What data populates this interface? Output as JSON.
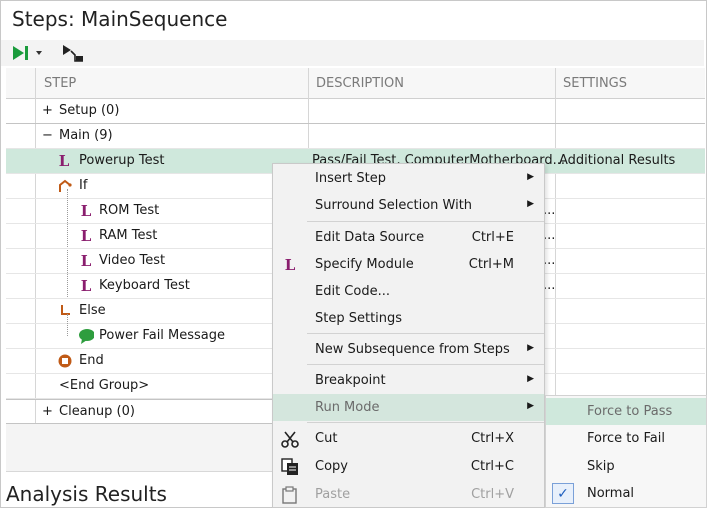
{
  "title": "Steps: MainSequence",
  "columns": [
    "STEP",
    "DESCRIPTION",
    "SETTINGS"
  ],
  "rows": [
    {
      "label": "Setup (0)",
      "expander": "+"
    },
    {
      "label": "Main (9)",
      "expander": "−"
    },
    {
      "label": "Powerup Test",
      "description": "Pass/Fail Test,  ComputerMotherboard...",
      "settings": "Additional Results",
      "icon": "labview-module-icon"
    },
    {
      "label": "If",
      "icon": "if-icon"
    },
    {
      "label": "ROM Test",
      "icon": "labview-module-icon",
      "description": "..."
    },
    {
      "label": "RAM Test",
      "icon": "labview-module-icon",
      "description": "..."
    },
    {
      "label": "Video Test",
      "icon": "labview-module-icon",
      "description": "..."
    },
    {
      "label": "Keyboard Test",
      "icon": "labview-module-icon",
      "description": "..."
    },
    {
      "label": "Else",
      "icon": "else-icon"
    },
    {
      "label": "Power Fail Message",
      "icon": "message-icon"
    },
    {
      "label": "End",
      "icon": "end-icon"
    },
    {
      "label": "<End Group>"
    },
    {
      "label": "Cleanup (0)",
      "expander": "+"
    }
  ],
  "analysis_title": "Analysis Results",
  "menu": {
    "insert_step": "Insert Step",
    "surround": "Surround Selection With",
    "edit_data_source": "Edit Data Source",
    "edit_data_source_sc": "Ctrl+E",
    "specify_module": "Specify Module",
    "specify_module_sc": "Ctrl+M",
    "edit_code": "Edit Code...",
    "step_settings": "Step Settings",
    "new_subsequence": "New Subsequence from Steps",
    "breakpoint": "Breakpoint",
    "run_mode": "Run Mode",
    "cut": "Cut",
    "cut_sc": "Ctrl+X",
    "copy": "Copy",
    "copy_sc": "Ctrl+C",
    "paste": "Paste",
    "paste_sc": "Ctrl+V"
  },
  "run_mode_submenu": [
    "Force to Pass",
    "Force to Fail",
    "Skip",
    "Normal"
  ],
  "colors": {
    "selection": "#cfe8dc",
    "module_icon": "#8a1e6e",
    "run_green": "#1a9b3c"
  }
}
